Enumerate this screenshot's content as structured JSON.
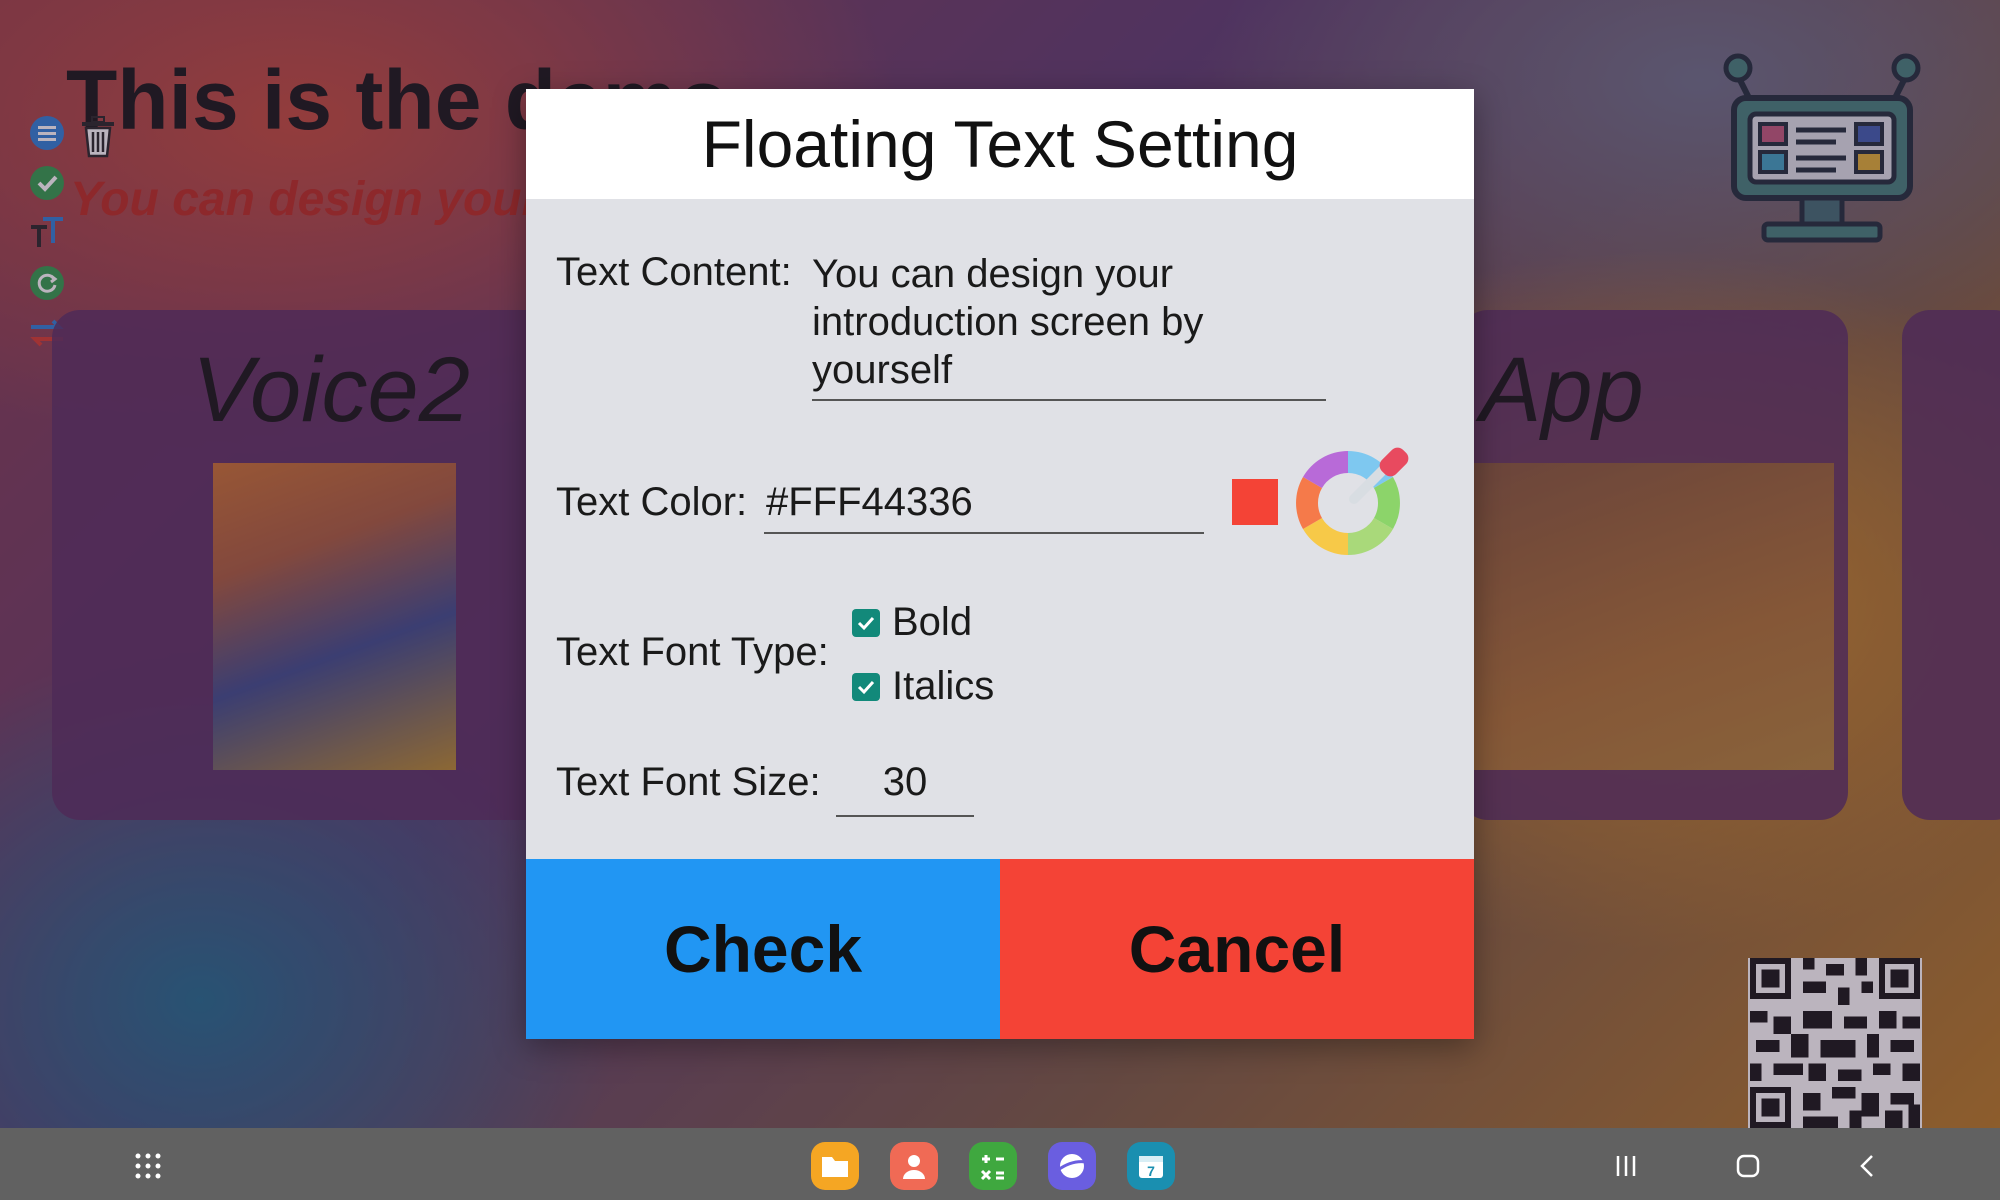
{
  "background_app": {
    "title": "This is the demo",
    "subtitle": "You can design your introduction screen by yourself",
    "card_left_label": "Voice2",
    "card_right_label": "App"
  },
  "dialog": {
    "title": "Floating Text Setting",
    "text_content_label": "Text Content:",
    "text_content_value": "You can design your introduction screen by yourself",
    "text_color_label": "Text Color:",
    "text_color_value": "#FFF44336",
    "swatch_color": "#f44336",
    "font_type_label": "Text Font Type:",
    "bold_label": "Bold",
    "bold_checked": true,
    "italics_label": "Italics",
    "italics_checked": true,
    "font_size_label": "Text Font Size:",
    "font_size_value": "30",
    "check_label": "Check",
    "cancel_label": "Cancel"
  },
  "taskbar": {
    "apps": [
      {
        "name": "my-files-icon",
        "color": "#f5a623"
      },
      {
        "name": "contacts-icon",
        "color": "#f06a55"
      },
      {
        "name": "calculator-icon",
        "color": "#3fa83f"
      },
      {
        "name": "internet-icon",
        "color": "#6a5ee0"
      },
      {
        "name": "calendar-icon",
        "color": "#1a8fb0",
        "badge": "7"
      }
    ]
  },
  "colors": {
    "check_button": "#2196f3",
    "cancel_button": "#f44336",
    "checkbox": "#12897a",
    "subtitle_text": "#b8281e"
  }
}
